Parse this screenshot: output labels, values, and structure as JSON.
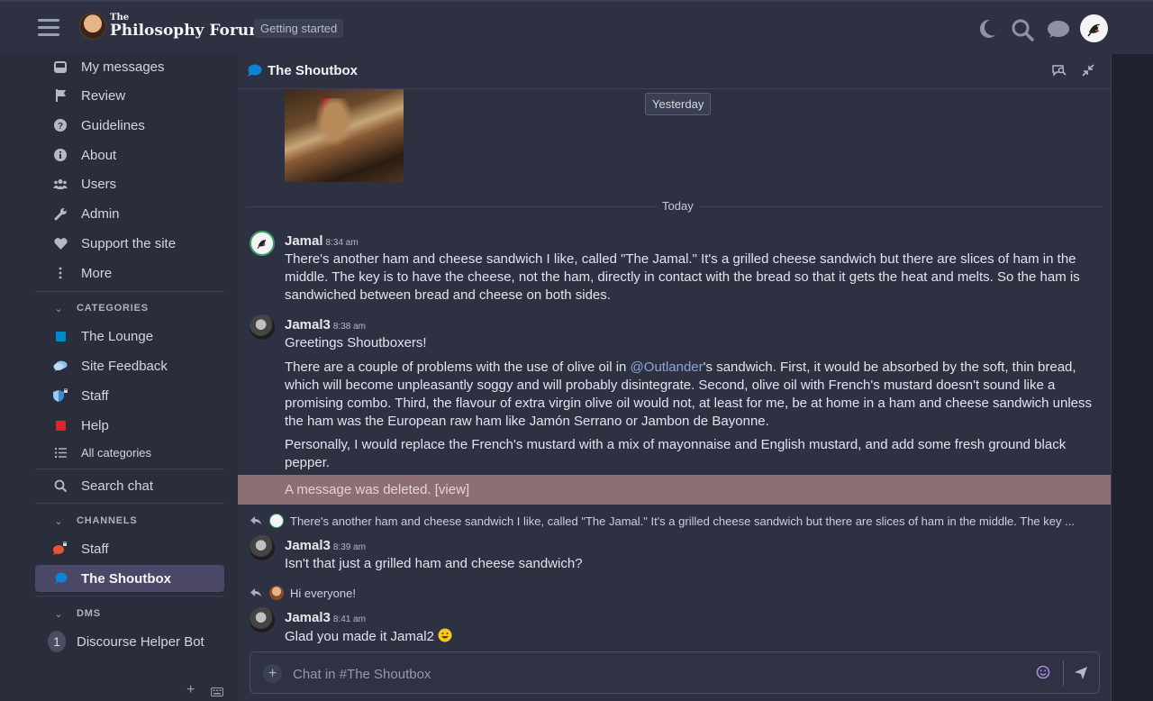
{
  "header": {
    "logo_the": "The",
    "logo_name": "Philosophy Forum",
    "getting_started": "Getting started"
  },
  "sidebar": {
    "items": [
      {
        "label": "My messages",
        "icon": "inbox-icon"
      },
      {
        "label": "Review",
        "icon": "flag-icon"
      },
      {
        "label": "Guidelines",
        "icon": "question-circle-icon"
      },
      {
        "label": "About",
        "icon": "info-circle-icon"
      },
      {
        "label": "Users",
        "icon": "users-icon"
      },
      {
        "label": "Admin",
        "icon": "wrench-icon"
      },
      {
        "label": "Support the site",
        "icon": "heart-icon"
      },
      {
        "label": "More",
        "icon": "vertical-ellipsis-icon"
      }
    ],
    "categories_heading": "CATEGORIES",
    "categories": [
      {
        "label": "The Lounge",
        "color": "#0088cc"
      },
      {
        "label": "Site Feedback",
        "color": "#8ec2ee"
      },
      {
        "label": "Staff",
        "color": "#3a8ad8"
      },
      {
        "label": "Help",
        "color": "#e0242a"
      }
    ],
    "all_categories": "All categories",
    "search_chat": "Search chat",
    "channels_heading": "CHANNELS",
    "channels": [
      {
        "label": "Staff",
        "color": "#e45735"
      },
      {
        "label": "The Shoutbox",
        "color": "#0b84d6"
      }
    ],
    "dms_heading": "DMS",
    "dms": [
      {
        "label": "Discourse Helper Bot",
        "badge": "1"
      }
    ]
  },
  "chat": {
    "title": "The Shoutbox",
    "yesterday_label": "Yesterday",
    "today_label": "Today",
    "messages": [
      {
        "user": "Jamal",
        "time": "8:34 am",
        "text": "There's another ham and cheese sandwich I like, called \"The Jamal.\" It's a grilled cheese sandwich but there are slices of ham in the middle. The key is to have the cheese, not the ham, directly in contact with the bread so that it gets the heat and melts. So the ham is sandwiched between bread and cheese on both sides."
      },
      {
        "user": "Jamal3",
        "time": "8:38 am",
        "p1": "Greetings Shoutboxers!",
        "p2_pre": "There are a couple of problems with the use of olive oil in ",
        "p2_mention": "@Outlander",
        "p2_post": "'s sandwich. First, it would be absorbed by the soft, thin bread, which will become unpleasantly soggy and will probably disintegrate. Second, olive oil with French's mustard doesn't sound like a promising combo. Third, the flavour of extra virgin olive oil would not, at least for me, be at home in a ham and cheese sandwich unless the ham was the European raw ham like Jamón Serrano or Jambon de Bayonne.",
        "p3": "Personally, I would replace the French's mustard with a mix of mayonnaise and English mustard, and add some fresh ground black pepper."
      },
      {
        "deleted_text": "A message was deleted. [view]"
      },
      {
        "reply_preview": "There's another ham and cheese sandwich I like, called \"The Jamal.\" It's a grilled cheese sandwich but there are slices of ham in the middle. The key ...",
        "user": "Jamal3",
        "time": "8:39 am",
        "text": "Isn't that just a grilled ham and cheese sandwich?"
      },
      {
        "reply_preview": "Hi everyone!",
        "user": "Jamal3",
        "time": "8:41 am",
        "text": "Glad you made it Jamal2"
      }
    ],
    "composer_placeholder": "Chat in #The Shoutbox"
  }
}
